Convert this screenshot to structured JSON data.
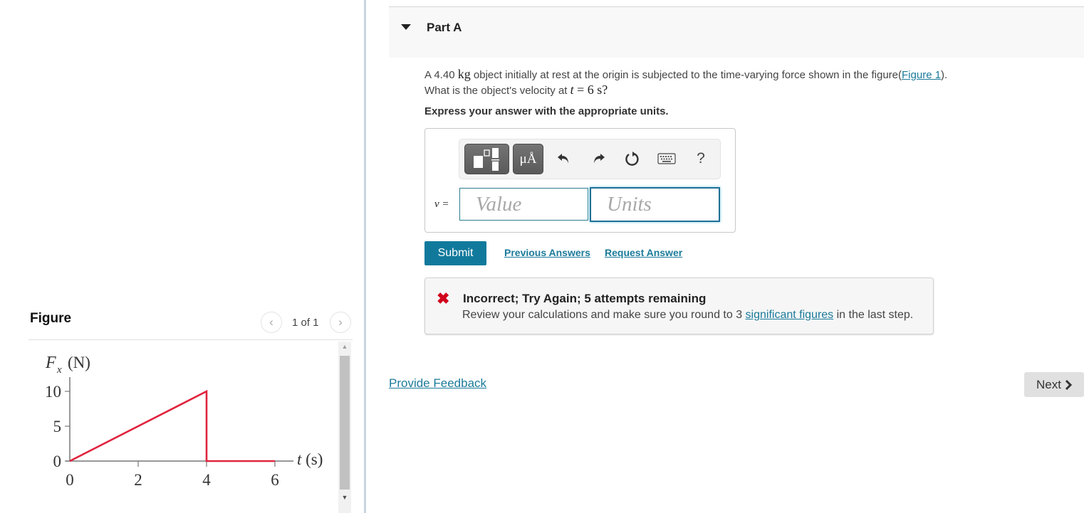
{
  "figure_panel": {
    "title": "Figure",
    "pager": "1 of 1",
    "prev_icon": "chevron-left-icon",
    "next_icon": "chevron-right-icon"
  },
  "chart_data": {
    "type": "line",
    "title": "",
    "xlabel": "t (s)",
    "ylabel_main": "F",
    "ylabel_sub": "x",
    "ylabel_unit": "(N)",
    "x_ticks": [
      0,
      2,
      4,
      6
    ],
    "y_ticks": [
      0,
      5,
      10
    ],
    "xlim": [
      0,
      6
    ],
    "ylim": [
      0,
      10
    ],
    "grid": false,
    "series": [
      {
        "name": "Fx",
        "color": "#e0243f",
        "points": [
          [
            0,
            0
          ],
          [
            4,
            10
          ],
          [
            4,
            0
          ],
          [
            6,
            0
          ]
        ]
      }
    ]
  },
  "part": {
    "caret_icon": "caret-down-icon",
    "title": "Part A",
    "question_pre": "A 4.40 ",
    "question_mass_unit": "kg",
    "question_mid": " object initially at rest at the origin is subjected to the time-varying force shown in the figure(",
    "figure_link": "Figure 1",
    "question_post": ").",
    "question_line2_pre": "What is the object's velocity at ",
    "question_line2_math": "t = 6 s?",
    "instruction": "Express your answer with the appropriate units."
  },
  "answer": {
    "toolbar": {
      "templates_icon": "templates-icon",
      "units_label": "μÅ",
      "undo_icon": "undo-icon",
      "redo_icon": "redo-icon",
      "reset_icon": "reset-icon",
      "keyboard_icon": "keyboard-icon",
      "help_label": "?"
    },
    "variable_label": "v =",
    "value": "",
    "value_placeholder": "Value",
    "units": "",
    "units_placeholder": "Units"
  },
  "actions": {
    "submit": "Submit",
    "previous_answers": "Previous Answers",
    "request_answer": "Request Answer"
  },
  "feedback": {
    "status_icon": "incorrect-x-icon",
    "status_color": "#d0021b",
    "title": "Incorrect; Try Again; 5 attempts remaining",
    "text_pre": "Review your calculations and make sure you round to 3 ",
    "text_link": "significant figures",
    "text_post": " in the last step."
  },
  "footer": {
    "provide_feedback": "Provide Feedback",
    "next": "Next"
  },
  "colors": {
    "accent": "#117a9c",
    "link": "#1b7a9a",
    "error": "#d0021b",
    "plot_line": "#e0243f"
  }
}
